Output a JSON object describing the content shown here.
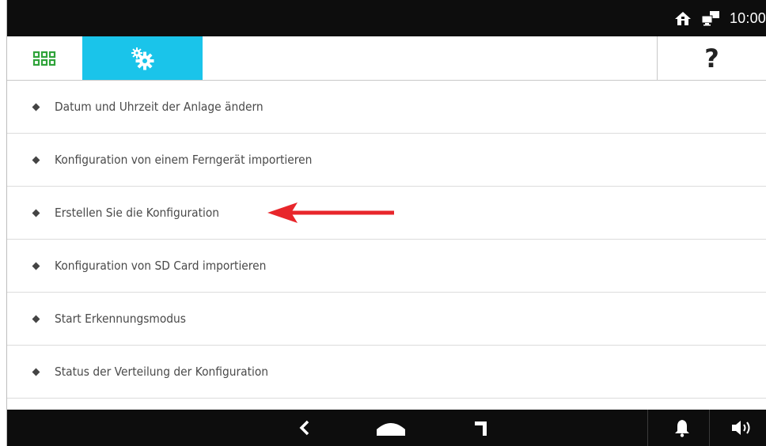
{
  "status": {
    "time": "10:00",
    "icons": [
      "home-status-icon",
      "network-status-icon"
    ]
  },
  "toolbar": {
    "apps_icon": "apps-grid-icon",
    "settings_icon": "gears-icon",
    "help_label": "?"
  },
  "menu": {
    "items": [
      {
        "label": "Datum und Uhrzeit der Anlage ändern"
      },
      {
        "label": "Konfiguration von einem Ferngerät importieren"
      },
      {
        "label": "Erstellen Sie die Konfiguration"
      },
      {
        "label": "Konfiguration von SD Card importieren"
      },
      {
        "label": "Start Erkennungsmodus"
      },
      {
        "label": "Status der Verteilung der Konfiguration"
      }
    ]
  },
  "annotation": {
    "arrow_color": "#e8262b",
    "points_to": "Erstellen Sie die Konfiguration"
  },
  "navbar": {
    "icons": [
      "back-icon",
      "home-icon",
      "recent-apps-icon",
      "bell-icon",
      "volume-icon"
    ]
  },
  "colors": {
    "accent": "#1ac4ea",
    "apps_green": "#2fa33a",
    "bars": "#0d0d0d"
  }
}
